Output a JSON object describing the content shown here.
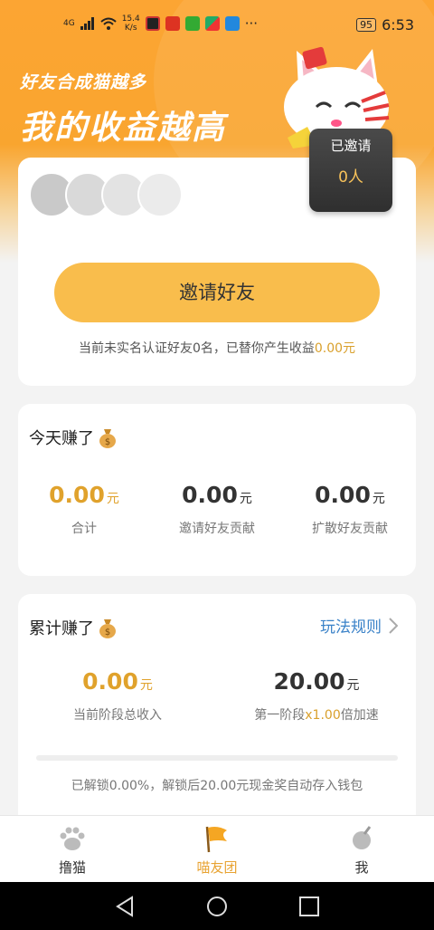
{
  "status_bar": {
    "network": "4G",
    "speed_value": "15.4",
    "speed_unit": "K/s",
    "battery": "95",
    "time": "6:53",
    "more": "···"
  },
  "hero": {
    "slogan_small": "好友合成猫越多",
    "slogan_large": "我的收益越高"
  },
  "invite": {
    "invited_label": "已邀请",
    "invited_count": "0人",
    "button_label": "邀请好友",
    "note_prefix": "当前未实名认证好友0名，已替你产生收益",
    "note_amount": "0.00元"
  },
  "today": {
    "title": "今天赚了",
    "stats": [
      {
        "value": "0.00",
        "unit": "元",
        "label": "合计"
      },
      {
        "value": "0.00",
        "unit": "元",
        "label": "邀请好友贡献"
      },
      {
        "value": "0.00",
        "unit": "元",
        "label": "扩散好友贡献"
      }
    ]
  },
  "total": {
    "title": "累计赚了",
    "rules_link": "玩法规则",
    "stage_income": {
      "value": "0.00",
      "unit": "元",
      "label": "当前阶段总收入"
    },
    "stage_target": {
      "value": "20.00",
      "unit": "元",
      "label_prefix": "第一阶段",
      "label_boost": "x1.00",
      "label_suffix": "倍加速"
    },
    "progress_fraction": 0.0,
    "unlock_note": "已解锁0.00%，解锁后20.00元现金奖自动存入钱包"
  },
  "tabs": [
    {
      "label": "撸猫",
      "icon": "paw-icon",
      "active": false
    },
    {
      "label": "喵友团",
      "icon": "flag-icon",
      "active": true
    },
    {
      "label": "我",
      "icon": "profile-icon",
      "active": false
    }
  ],
  "colors": {
    "brand_orange": "#fca533",
    "button_yellow": "#f9bd4c",
    "gold_text": "#e0a22c",
    "link_blue": "#3a82c8"
  }
}
